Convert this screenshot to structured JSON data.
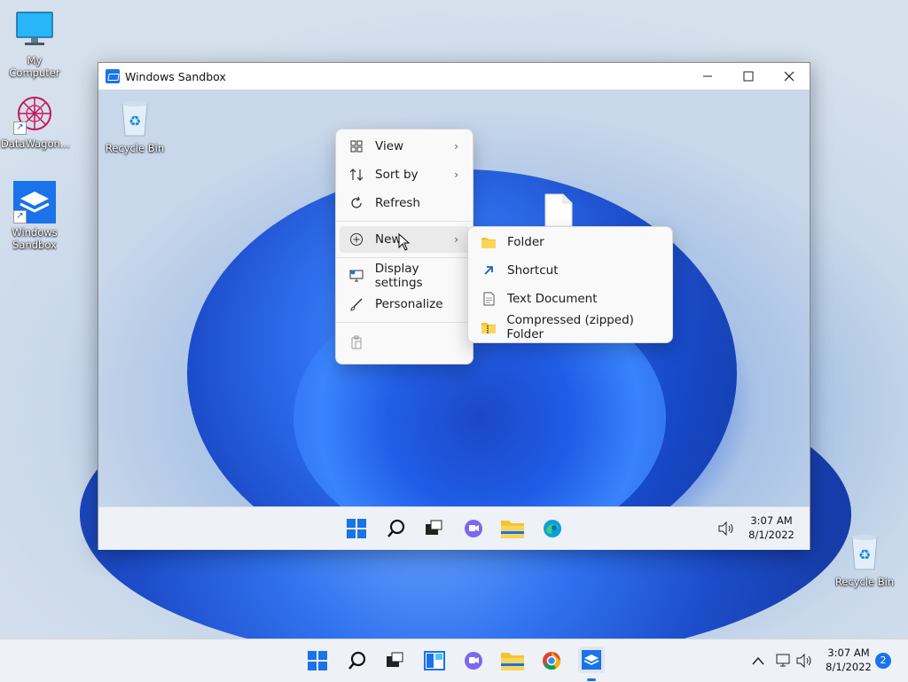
{
  "desktop": {
    "icons": [
      {
        "label": "My Computer",
        "icon": "monitor-icon"
      },
      {
        "label": "DataWagon...",
        "icon": "datawagon-icon"
      },
      {
        "label": "Windows Sandbox",
        "icon": "sandbox-icon"
      },
      {
        "label": "Recycle Bin",
        "icon": "recycle-bin-icon"
      }
    ]
  },
  "sandbox_window": {
    "title": "Windows Sandbox",
    "desktop_icons": [
      {
        "label": "Recycle Bin",
        "icon": "recycle-bin-icon"
      }
    ],
    "context_menu": {
      "items": [
        {
          "label": "View",
          "icon": "view-grid-icon",
          "submenu": true
        },
        {
          "label": "Sort by",
          "icon": "sort-icon",
          "submenu": true
        },
        {
          "label": "Refresh",
          "icon": "refresh-icon"
        },
        {
          "label": "New",
          "icon": "new-plus-icon",
          "submenu": true
        },
        {
          "label": "Display settings",
          "icon": "display-settings-icon"
        },
        {
          "label": "Personalize",
          "icon": "personalize-brush-icon"
        },
        {
          "label": "",
          "icon": "paste-icon"
        }
      ]
    },
    "new_submenu": {
      "items": [
        {
          "label": "Folder",
          "icon": "folder-icon"
        },
        {
          "label": "Shortcut",
          "icon": "shortcut-arrow-icon"
        },
        {
          "label": "Text Document",
          "icon": "text-document-icon"
        },
        {
          "label": "Compressed (zipped) Folder",
          "icon": "zip-folder-icon"
        }
      ]
    },
    "taskbar": {
      "time": "3:07 AM",
      "date": "8/1/2022"
    }
  },
  "host_taskbar": {
    "time": "3:07 AM",
    "date": "8/1/2022",
    "notification_count": "2"
  },
  "colors": {
    "accent": "#1a73e8",
    "folder": "#f4c430"
  }
}
